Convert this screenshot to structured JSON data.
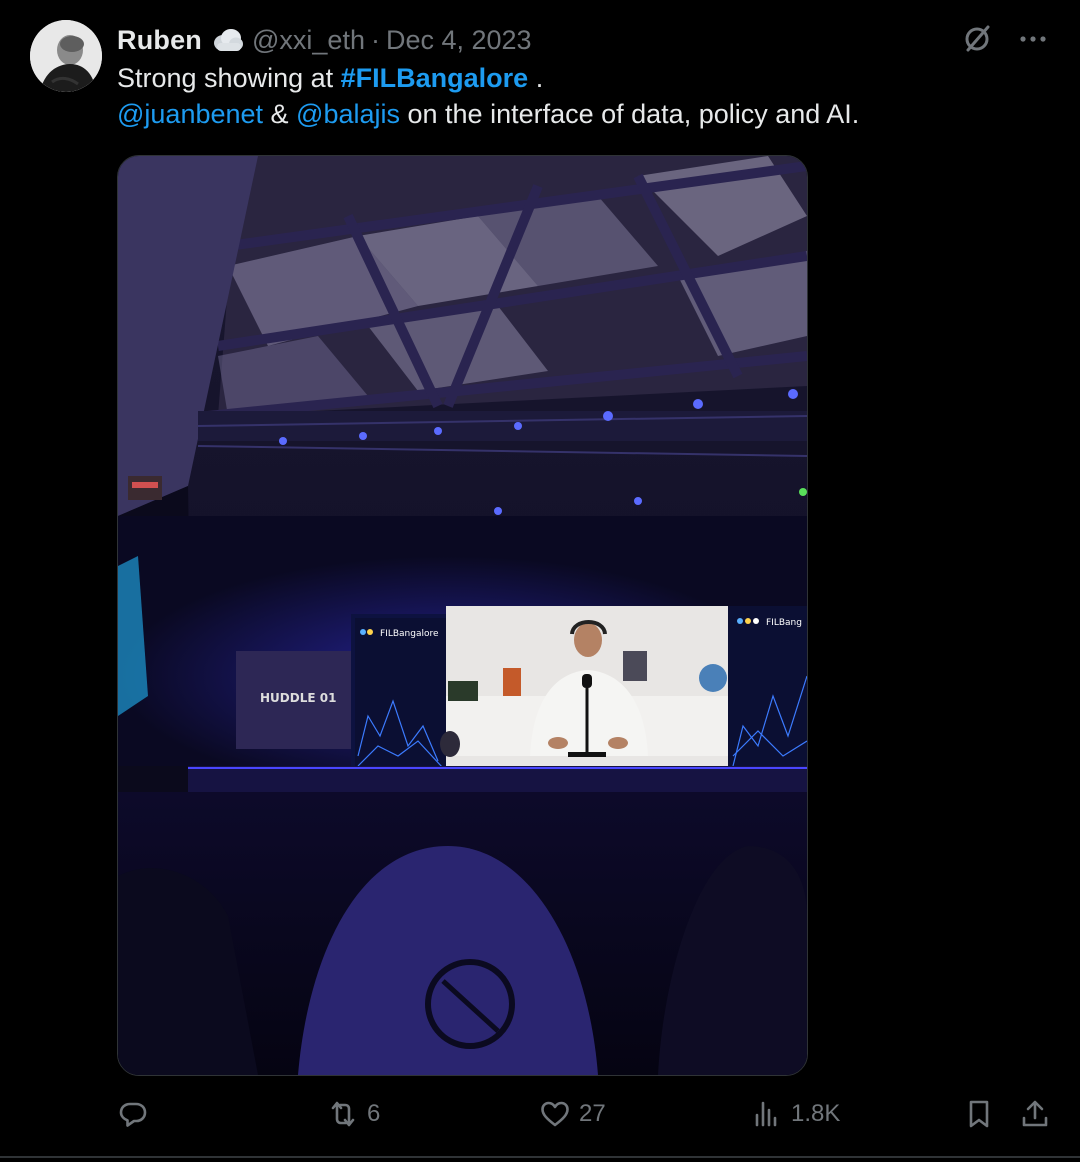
{
  "tweet": {
    "author": {
      "name": "Ruben",
      "handle": "@xxi_eth",
      "separator": "·",
      "date": "Dec 4, 2023",
      "avatar_icon": "avatar-photo",
      "badge_icon": "cloud-emoji"
    },
    "text": {
      "line1_prefix": "Strong showing at ",
      "hashtag": "#FILBangalore",
      "line1_suffix": " .",
      "mention1": "@juanbenet",
      "amp": " & ",
      "mention2": "@balajis",
      "line2_suffix": " on the interface of data, policy and AI."
    },
    "media": {
      "screen_title": "FILBangalore",
      "screen_title_right": "FILBang",
      "backdrop_text": "HUDDLE 01"
    },
    "actions": {
      "reply": {
        "icon": "reply-icon",
        "count": ""
      },
      "repost": {
        "icon": "repost-icon",
        "count": "6"
      },
      "like": {
        "icon": "heart-icon",
        "count": "27"
      },
      "views": {
        "icon": "views-icon",
        "count": "1.8K"
      },
      "bookmark": {
        "icon": "bookmark-icon"
      },
      "share": {
        "icon": "share-icon"
      }
    },
    "colors": {
      "background": "#000000",
      "text": "#e7e9ea",
      "muted": "#71767b",
      "accent": "#1d9bf0"
    }
  }
}
